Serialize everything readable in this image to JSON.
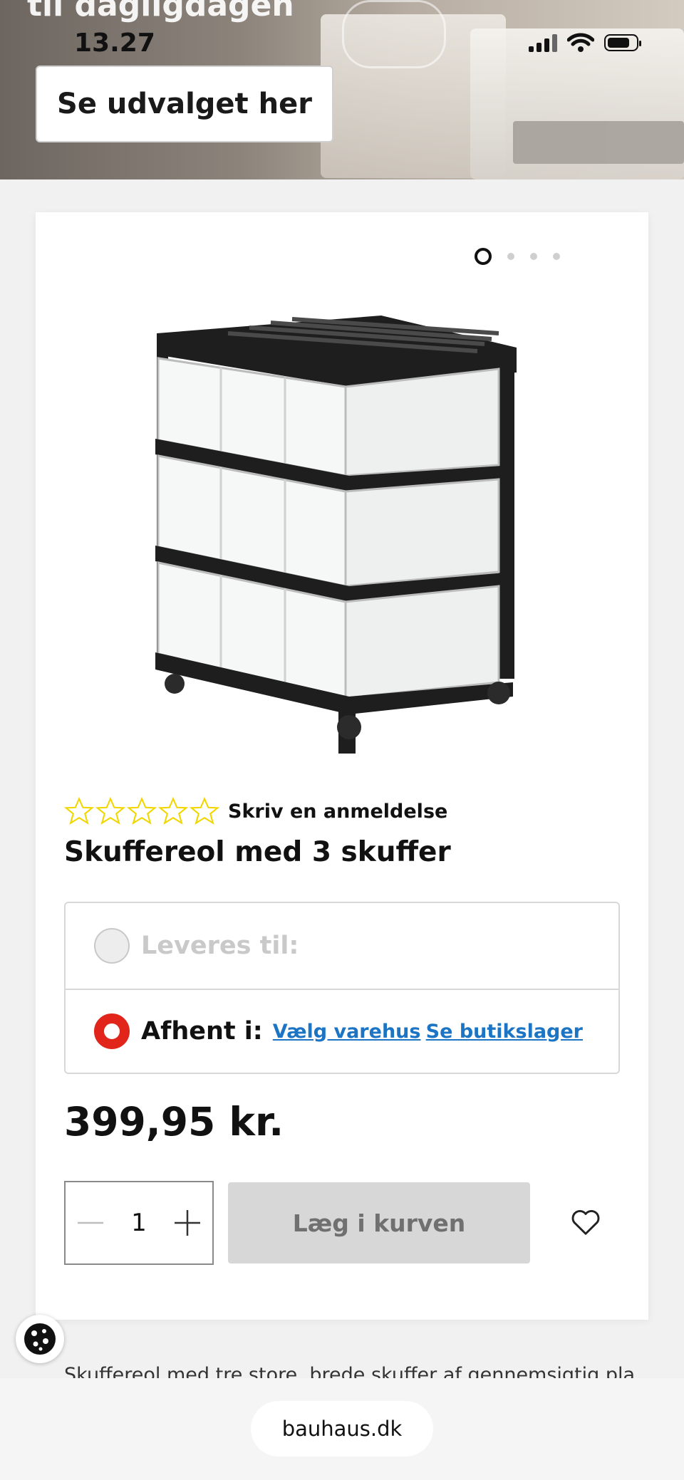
{
  "status_bar": {
    "time": "13.27"
  },
  "hero": {
    "headline": "til dagligdagen",
    "button_label": "Se udvalget her"
  },
  "gallery": {
    "image_count": 4,
    "active_index": 0
  },
  "product": {
    "rating_stars": 0,
    "review_link": "Skriv en anmeldelse",
    "title": "Skuffereol med 3 skuffer",
    "price": "399,95 kr."
  },
  "delivery": {
    "ship_label": "Leveres til:",
    "pickup_label": "Afhent i:",
    "choose_store_link": "Vælg varehus",
    "store_stock_link": "Se butikslager"
  },
  "cart": {
    "quantity": "1",
    "add_button": "Læg i kurven"
  },
  "description_preview": "Skuffereol med tre store, brede skuffer af gennemsigtig plast.",
  "browser": {
    "url": "bauhaus.dk"
  },
  "colors": {
    "accent_red": "#e1251b",
    "link_blue": "#1c74c4",
    "star_yellow": "#f2d600",
    "disabled_gray": "#d7d7d7"
  }
}
